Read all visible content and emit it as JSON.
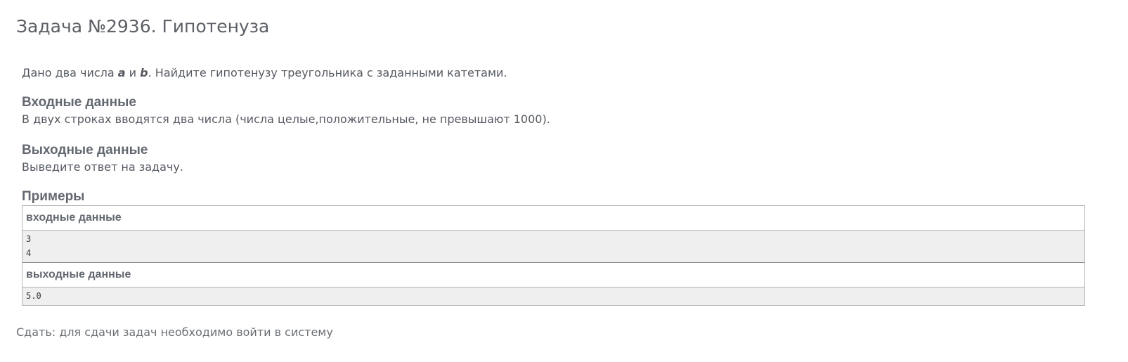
{
  "problem": {
    "title": "Задача №2936. Гипотенуза"
  },
  "legend": {
    "prefix": "Дано два числа ",
    "var_a": "a",
    "middle": " и ",
    "var_b": "b",
    "suffix": ". Найдите гипотенузу треугольника с заданными катетами."
  },
  "input_section": {
    "heading": "Входные данные",
    "text": "В двух строках вводятся два числа (числа целые,положительные, не превышают 1000)."
  },
  "output_section": {
    "heading": "Выходные данные",
    "text": "Выведите ответ на задачу."
  },
  "examples": {
    "heading": "Примеры",
    "input_label": "входные данные",
    "input_lines": [
      "3",
      "4"
    ],
    "output_label": "выходные данные",
    "output_lines": [
      "5.0"
    ]
  },
  "footer": {
    "submit_note": "Сдать: для сдачи задач необходимо войти в систему"
  }
}
